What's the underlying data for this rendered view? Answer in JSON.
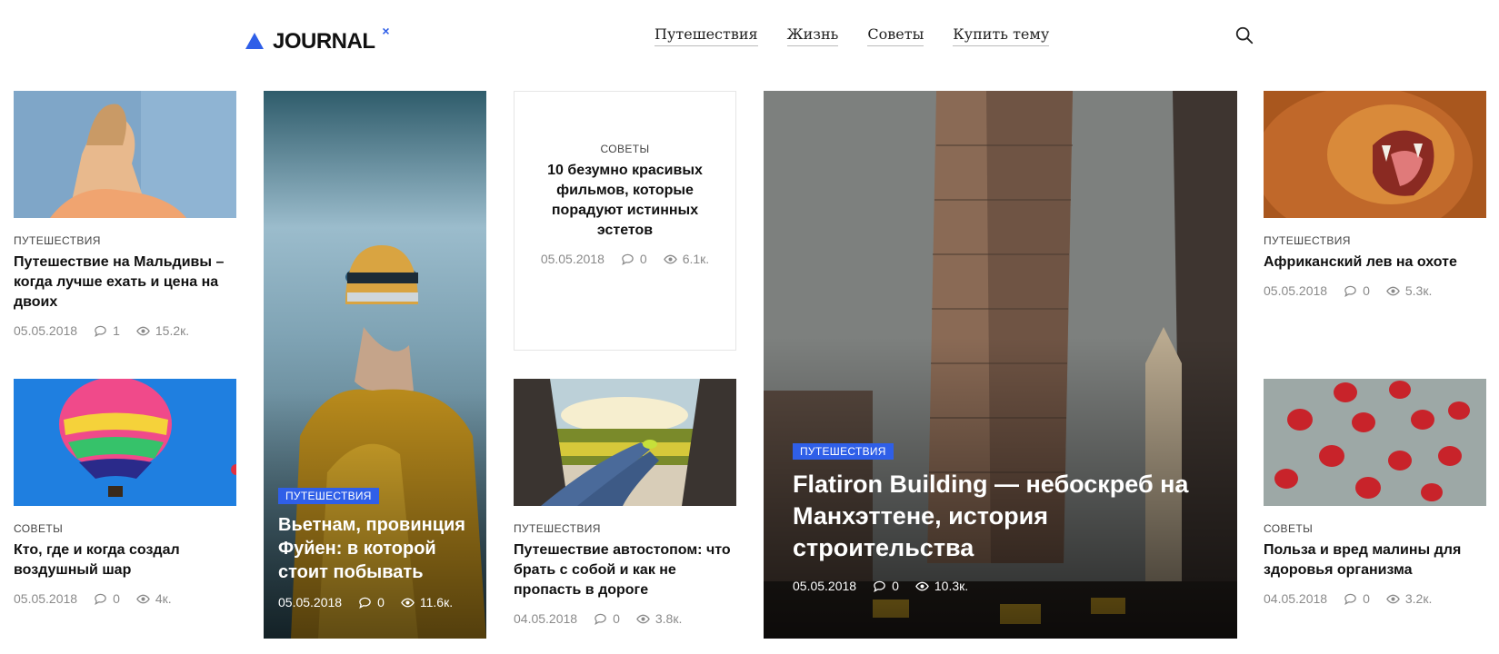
{
  "header": {
    "logo_text": "JOURNAL",
    "logo_mark": "×",
    "nav": [
      "Путешествия",
      "Жизнь",
      "Советы",
      "Купить тему"
    ],
    "search_icon": "search-icon"
  },
  "colors": {
    "accent": "#2f5fe8"
  },
  "cards": {
    "maldives": {
      "category": "ПУТЕШЕСТВИЯ",
      "title": "Путешествие на Мальдивы – когда лучше ехать и цена на двоих",
      "date": "05.05.2018",
      "comments": "1",
      "views": "15.2к."
    },
    "vietnam": {
      "category": "ПУТЕШЕСТВИЯ",
      "title": "Вьетнам, провинция Фуйен: в которой стоит побывать",
      "date": "05.05.2018",
      "comments": "0",
      "views": "11.6к."
    },
    "films": {
      "category": "СОВЕТЫ",
      "title": "10 безумно красивых фильмов, которые порадуют истинных эстетов",
      "date": "05.05.2018",
      "comments": "0",
      "views": "6.1к."
    },
    "flatiron": {
      "category": "ПУТЕШЕСТВИЯ",
      "title": "Flatiron Building — небоскреб на Манхэттене, история строительства",
      "date": "05.05.2018",
      "comments": "0",
      "views": "10.3к."
    },
    "lion": {
      "category": "ПУТЕШЕСТВИЯ",
      "title": "Африканский лев на охоте",
      "date": "05.05.2018",
      "comments": "0",
      "views": "5.3к."
    },
    "balloon": {
      "category": "СОВЕТЫ",
      "title": "Кто, где и когда создал воздушный шар",
      "date": "05.05.2018",
      "comments": "0",
      "views": "4к."
    },
    "hitchhike": {
      "category": "ПУТЕШЕСТВИЯ",
      "title": "Путешествие автостопом: что брать с собой и как не пропасть в дороге",
      "date": "04.05.2018",
      "comments": "0",
      "views": "3.8к."
    },
    "raspberry": {
      "category": "СОВЕТЫ",
      "title": "Польза и вред малины для здоровья организма",
      "date": "04.05.2018",
      "comments": "0",
      "views": "3.2к."
    }
  }
}
